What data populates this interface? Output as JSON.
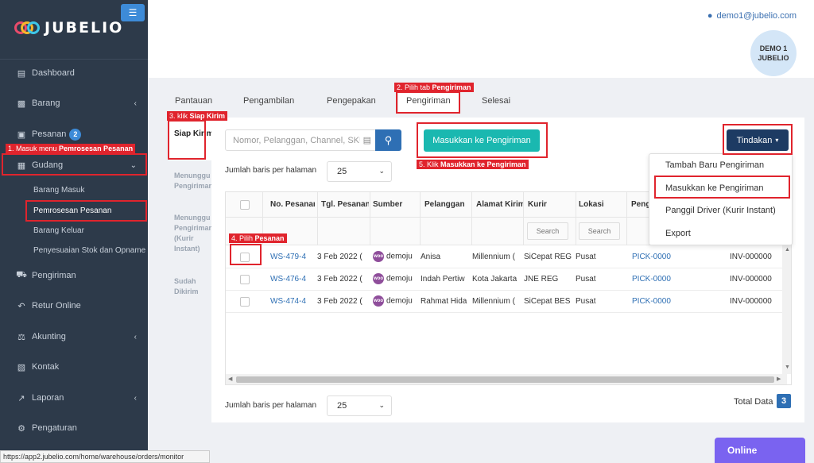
{
  "app": {
    "logo_text": "JUBELIO",
    "user_email": "demo1@jubelio.com",
    "avatar_text": "DEMO 1 JUBELIO",
    "status_url": "https://app2.jubelio.com/home/warehouse/orders/monitor",
    "online_label": "Online"
  },
  "sidebar": {
    "items": [
      {
        "label": "Dashboard",
        "icon": "chart-icon"
      },
      {
        "label": "Barang",
        "icon": "cubes-icon"
      },
      {
        "label": "Pesanan",
        "icon": "basket-icon",
        "badge": "2"
      },
      {
        "label": "Gudang",
        "icon": "building-icon"
      },
      {
        "label": "Pengiriman",
        "icon": "truck-icon"
      },
      {
        "label": "Retur Online",
        "icon": "reply-icon"
      },
      {
        "label": "Akunting",
        "icon": "scale-icon"
      },
      {
        "label": "Kontak",
        "icon": "contact-card-icon"
      },
      {
        "label": "Laporan",
        "icon": "line-chart-icon"
      },
      {
        "label": "Pengaturan",
        "icon": "gears-icon"
      }
    ],
    "sub_items": [
      "Barang Masuk",
      "Pemrosesan Pesanan",
      "Barang Keluar",
      "Penyesuaian Stok dan Opname"
    ]
  },
  "tabs": [
    "Pantauan",
    "Pengambilan",
    "Pengepakan",
    "Pengiriman",
    "Selesai"
  ],
  "substatus": {
    "siap_kirim": "Siap Kirim",
    "menunggu_pengiriman": "Menunggu Pengiriman",
    "menunggu_kurir": "Menunggu Pengiriman (Kurir Instant)",
    "sudah_dikirim": "Sudah Dikirim"
  },
  "toolbar": {
    "search_placeholder": "Nomor, Pelanggan, Channel, SKU",
    "masukkan_label": "Masukkan ke Pengiriman",
    "tindakan_label": "Tindakan"
  },
  "rows_per_page": {
    "label": "Jumlah baris per halaman",
    "value": "25"
  },
  "table": {
    "columns": [
      "No. Pesanan",
      "Tgl. Pesanan",
      "Sumber",
      "Pelanggan",
      "Alamat Kirim",
      "Kurir",
      "Lokasi",
      "Pengambilan"
    ],
    "filter_label": "Search",
    "rows": [
      {
        "no": "WS-479-4",
        "tgl": "3 Feb 2022 (",
        "sumber": "demoju",
        "pelanggan": "Anisa",
        "alamat": "Millennium (",
        "kurir": "SiCepat REG",
        "lokasi": "Pusat",
        "pick": "PICK-0000",
        "inv": "INV-000000"
      },
      {
        "no": "WS-476-4",
        "tgl": "3 Feb 2022 (",
        "sumber": "demoju",
        "pelanggan": "Indah Pertiw",
        "alamat": "Kota Jakarta",
        "kurir": "JNE REG",
        "lokasi": "Pusat",
        "pick": "PICK-0000",
        "inv": "INV-000000"
      },
      {
        "no": "WS-474-4",
        "tgl": "3 Feb 2022 (",
        "sumber": "demoju",
        "pelanggan": "Rahmat Hida",
        "alamat": "Millennium (",
        "kurir": "SiCepat BES",
        "lokasi": "Pusat",
        "pick": "PICK-0000",
        "inv": "INV-000000"
      }
    ],
    "source_badge": "woo"
  },
  "total": {
    "label": "Total Data",
    "value": "3"
  },
  "menu": {
    "items": [
      "Tambah Baru Pengiriman",
      "Masukkan ke Pengiriman",
      "Panggil Driver (Kurir Instant)",
      "Export"
    ]
  },
  "annotations": {
    "a1_prefix": "1. Masuk menu ",
    "a1_bold": "Pemrosesan Pesanan",
    "a2_prefix": "2. Pilih tab ",
    "a2_bold": "Pengiriman",
    "a3_prefix": "3. klik ",
    "a3_bold": "Siap Kirim",
    "a4_prefix": "4. Pilih ",
    "a4_bold": "Pesanan",
    "a5_prefix": "5. Klik ",
    "a5_bold": "Masukkan ke Pengiriman"
  },
  "colors": {
    "sidebar": "#2d3a4a",
    "primary": "#2e6fb4",
    "teal": "#1ab8b0",
    "navy": "#1d3b63",
    "annotation": "#e0242d",
    "online": "#7a63f0"
  }
}
